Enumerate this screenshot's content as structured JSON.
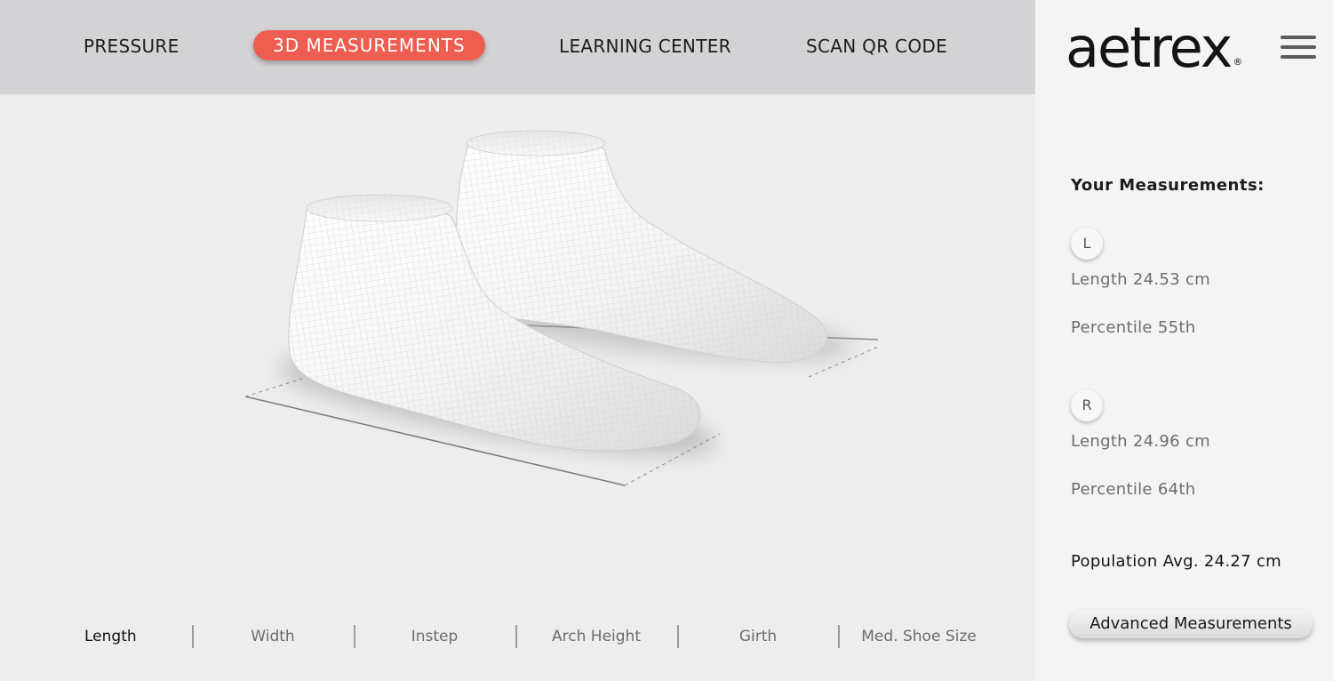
{
  "nav": {
    "items": [
      {
        "label": "PRESSURE",
        "active": false
      },
      {
        "label": "3D MEASUREMENTS",
        "active": true
      },
      {
        "label": "LEARNING CENTER",
        "active": false
      },
      {
        "label": "SCAN QR CODE",
        "active": false
      }
    ],
    "accent_color": "#ee5e50"
  },
  "brand": {
    "name": "aetrex",
    "registered_mark": "®"
  },
  "menu": {
    "icon": "hamburger-menu-icon"
  },
  "measurements": {
    "heading": "Your Measurements:",
    "left": {
      "badge": "L",
      "length": "Length 24.53 cm",
      "percentile": "Percentile 55th"
    },
    "right": {
      "badge": "R",
      "length": "Length 24.96 cm",
      "percentile": "Percentile 64th"
    },
    "population_avg": "Population Avg. 24.27 cm",
    "advanced_button": "Advanced Measurements"
  },
  "viewer": {
    "content": "3d-foot-scan-model"
  },
  "metric_tabs": [
    {
      "label": "Length",
      "active": true
    },
    {
      "label": "Width",
      "active": false
    },
    {
      "label": "Instep",
      "active": false
    },
    {
      "label": "Arch Height",
      "active": false
    },
    {
      "label": "Girth",
      "active": false
    },
    {
      "label": "Med. Shoe Size",
      "active": false
    }
  ]
}
